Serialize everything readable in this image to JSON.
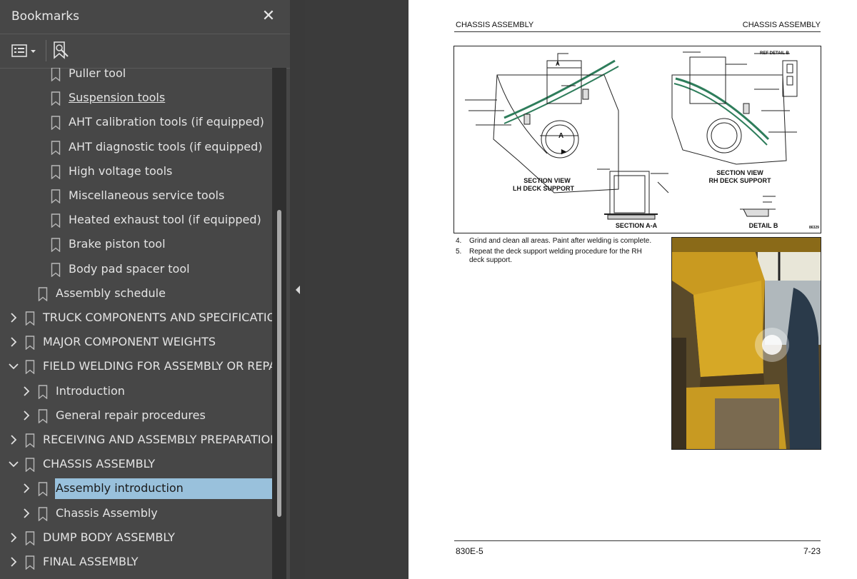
{
  "sidebar": {
    "title": "Bookmarks",
    "close_icon": "close-icon",
    "options_icon": "bookmark-options-icon",
    "find_icon": "find-bookmark-icon",
    "items": [
      {
        "label": "Puller tool",
        "chevron": ""
      },
      {
        "label": "Suspension tools",
        "chevron": ""
      },
      {
        "label": "AHT calibration tools (if equipped)",
        "chevron": ""
      },
      {
        "label": "AHT diagnostic tools (if equipped)",
        "chevron": ""
      },
      {
        "label": "High voltage tools",
        "chevron": ""
      },
      {
        "label": "Miscellaneous service tools",
        "chevron": ""
      },
      {
        "label": "Heated exhaust tool (if equipped)",
        "chevron": ""
      },
      {
        "label": "Brake piston tool",
        "chevron": ""
      },
      {
        "label": "Body pad spacer tool",
        "chevron": ""
      },
      {
        "label": "Assembly schedule",
        "chevron": ""
      },
      {
        "label": "TRUCK COMPONENTS AND SPECIFICATIONS",
        "chevron": "collapsed"
      },
      {
        "label": "MAJOR COMPONENT WEIGHTS",
        "chevron": "collapsed"
      },
      {
        "label": "FIELD WELDING FOR ASSEMBLY OR REPAIR",
        "chevron": "expanded"
      },
      {
        "label": "Introduction",
        "chevron": "collapsed"
      },
      {
        "label": "General repair procedures",
        "chevron": "collapsed"
      },
      {
        "label": "RECEIVING AND ASSEMBLY PREPARATION",
        "chevron": "collapsed"
      },
      {
        "label": "CHASSIS ASSEMBLY",
        "chevron": "expanded"
      },
      {
        "label": "Assembly introduction",
        "chevron": "collapsed",
        "selected": true
      },
      {
        "label": "Chassis Assembly",
        "chevron": "collapsed"
      },
      {
        "label": "DUMP BODY ASSEMBLY",
        "chevron": "collapsed"
      },
      {
        "label": "FINAL ASSEMBLY",
        "chevron": "collapsed"
      }
    ]
  },
  "page": {
    "header_left": "CHASSIS ASSEMBLY",
    "header_right": "CHASSIS ASSEMBLY",
    "figure": {
      "labels": {
        "lh_section": "SECTION VIEW",
        "lh_deck": "LH DECK SUPPORT",
        "rh_section": "SECTION VIEW",
        "rh_deck": "RH DECK SUPPORT",
        "section_aa": "SECTION A-A",
        "detail_b": "DETAIL B",
        "ref_detail": "REF DETAIL B",
        "arrow_a": "A",
        "arrow_a2": "A",
        "fig_id": "86329"
      }
    },
    "steps": [
      {
        "num": "4.",
        "text": "Grind and clean all areas. Paint after welding is complete."
      },
      {
        "num": "5.",
        "text": "Repeat the deck support welding procedure for the RH deck support."
      }
    ],
    "footer_left": "830E-5",
    "footer_right": "7-23"
  },
  "colors": {
    "sidebar_bg": "#474747",
    "selection": "#99c1dc",
    "page_bg": "#ffffff",
    "viewer_bg": "#3b3b3b"
  }
}
